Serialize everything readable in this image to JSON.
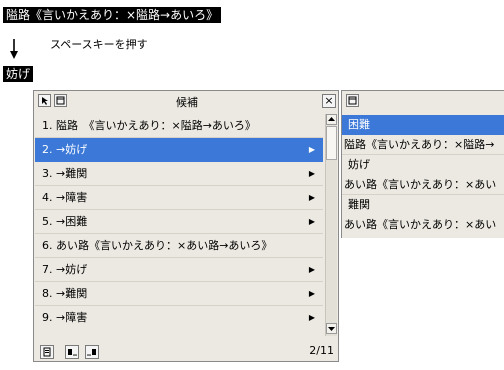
{
  "preedit": {
    "text": "隘路《言いかえあり：×隘路→あいろ》"
  },
  "instruction": {
    "text": "スペースキーを押す"
  },
  "committed": {
    "text": "妨げ"
  },
  "candidate_window": {
    "title": "候補",
    "close_label": "×",
    "page_indicator": "2/11",
    "items": [
      {
        "label": "1. 隘路　《言いかえあり：×隘路→あいろ》",
        "has_submenu": false,
        "selected": false
      },
      {
        "label": "2. →妨げ",
        "has_submenu": true,
        "selected": true
      },
      {
        "label": "3. →難関",
        "has_submenu": true,
        "selected": false
      },
      {
        "label": "4. →障害",
        "has_submenu": true,
        "selected": false
      },
      {
        "label": "5. →困難",
        "has_submenu": true,
        "selected": false
      },
      {
        "label": "6. あい路《言いかえあり：×あい路→あいろ》",
        "has_submenu": false,
        "selected": false
      },
      {
        "label": "7. →妨げ",
        "has_submenu": true,
        "selected": false
      },
      {
        "label": "8. →難関",
        "has_submenu": true,
        "selected": false
      },
      {
        "label": "9. →障害",
        "has_submenu": true,
        "selected": false
      }
    ]
  },
  "sub_window": {
    "items": [
      {
        "label": "困難",
        "kind": "candidate",
        "selected": true
      },
      {
        "label": "隘路《言いかえあり：×隘路→",
        "kind": "annotation",
        "selected": false
      },
      {
        "label": "妨げ",
        "kind": "candidate",
        "selected": false
      },
      {
        "label": "あい路《言いかえあり：×あい",
        "kind": "annotation",
        "selected": false
      },
      {
        "label": "難関",
        "kind": "candidate",
        "selected": false
      },
      {
        "label": "あい路《言いかえあり：×あい",
        "kind": "annotation",
        "selected": false
      }
    ]
  },
  "colors": {
    "selection": "#3b78d8",
    "window_background": "#ece9e2",
    "preedit_background": "#000000",
    "preedit_text": "#ffffff"
  }
}
